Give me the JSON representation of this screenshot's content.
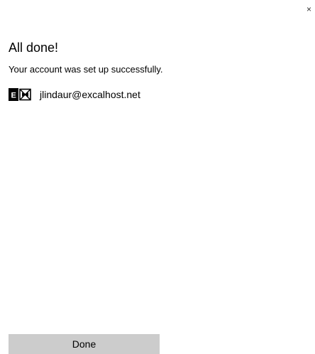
{
  "dialog": {
    "close_glyph": "×",
    "title": "All done!",
    "subtitle": "Your account was set up successfully.",
    "account": {
      "icon": "exchange-icon",
      "email": "jlindaur@excalhost.net"
    },
    "done_label": "Done"
  },
  "colors": {
    "background": "#ffffff",
    "button": "#cccccc",
    "text": "#000000",
    "icon": "#000000"
  }
}
